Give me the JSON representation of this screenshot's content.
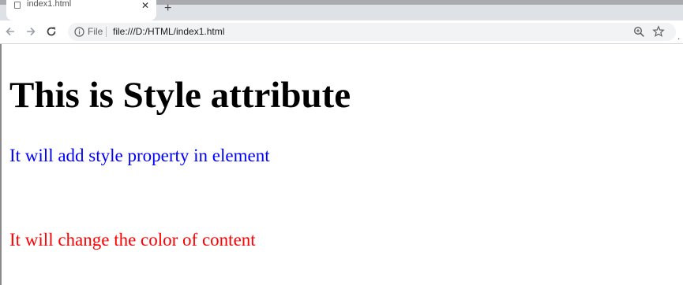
{
  "browser": {
    "tab": {
      "title": "index1.html",
      "close_glyph": "✕",
      "favicon_icon": "file-icon"
    },
    "new_tab_glyph": "+",
    "toolbar": {
      "back_icon": "arrow-left-icon",
      "forward_icon": "arrow-right-icon",
      "reload_icon": "reload-icon"
    },
    "address_bar": {
      "scheme_label": "File",
      "url": "file:///D:/HTML/index1.html",
      "info_icon": "info-icon",
      "zoom_icon": "zoom-icon",
      "bookmark_icon": "star-icon"
    },
    "menu_glyph": "."
  },
  "page": {
    "heading": "This is Style attribute",
    "paragraph_blue": "It will add style property in element",
    "paragraph_red": "It will change the color of content",
    "colors": {
      "heading": "#000000",
      "paragraph_blue": "#0000ff",
      "paragraph_red": "#ff0000"
    }
  }
}
